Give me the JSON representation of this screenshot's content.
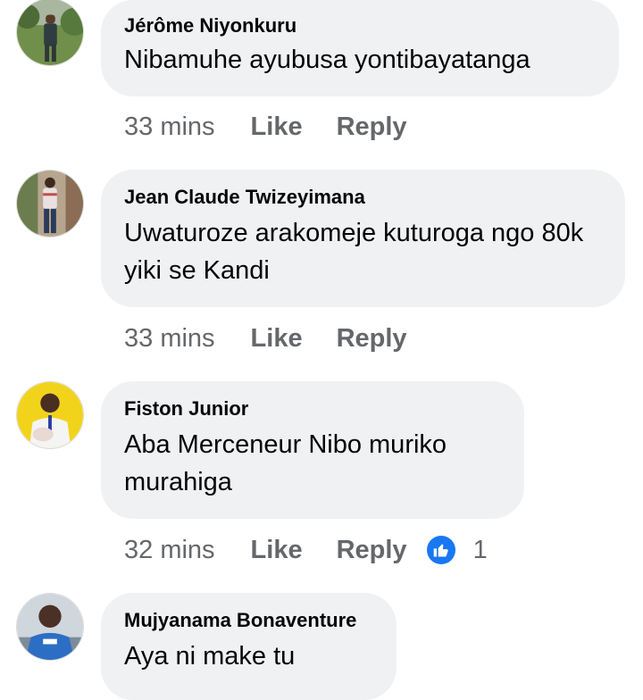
{
  "comments": [
    {
      "author": "Jérôme Niyonkuru",
      "text": "Nibamuhe ayubusa yontibayatanga",
      "time": "33 mins",
      "like_label": "Like",
      "reply_label": "Reply"
    },
    {
      "author": "Jean Claude Twizeyimana",
      "text": "Uwaturoze arakomeje kuturoga ngo 80k yiki se Kandi",
      "time": "33 mins",
      "like_label": "Like",
      "reply_label": "Reply"
    },
    {
      "author": "Fiston Junior",
      "text": "Aba Merceneur Nibo muriko murahiga",
      "time": "32 mins",
      "like_label": "Like",
      "reply_label": "Reply",
      "reactions": {
        "icon": "thumbs-up-icon",
        "count": "1"
      }
    },
    {
      "author": "Mujyanama Bonaventure",
      "text": "Aya ni make tu"
    }
  ],
  "colors": {
    "bubble": "#eff1f3",
    "secondary_text": "#65676b",
    "primary_text": "#050505",
    "like_blue": "#1877f2"
  }
}
